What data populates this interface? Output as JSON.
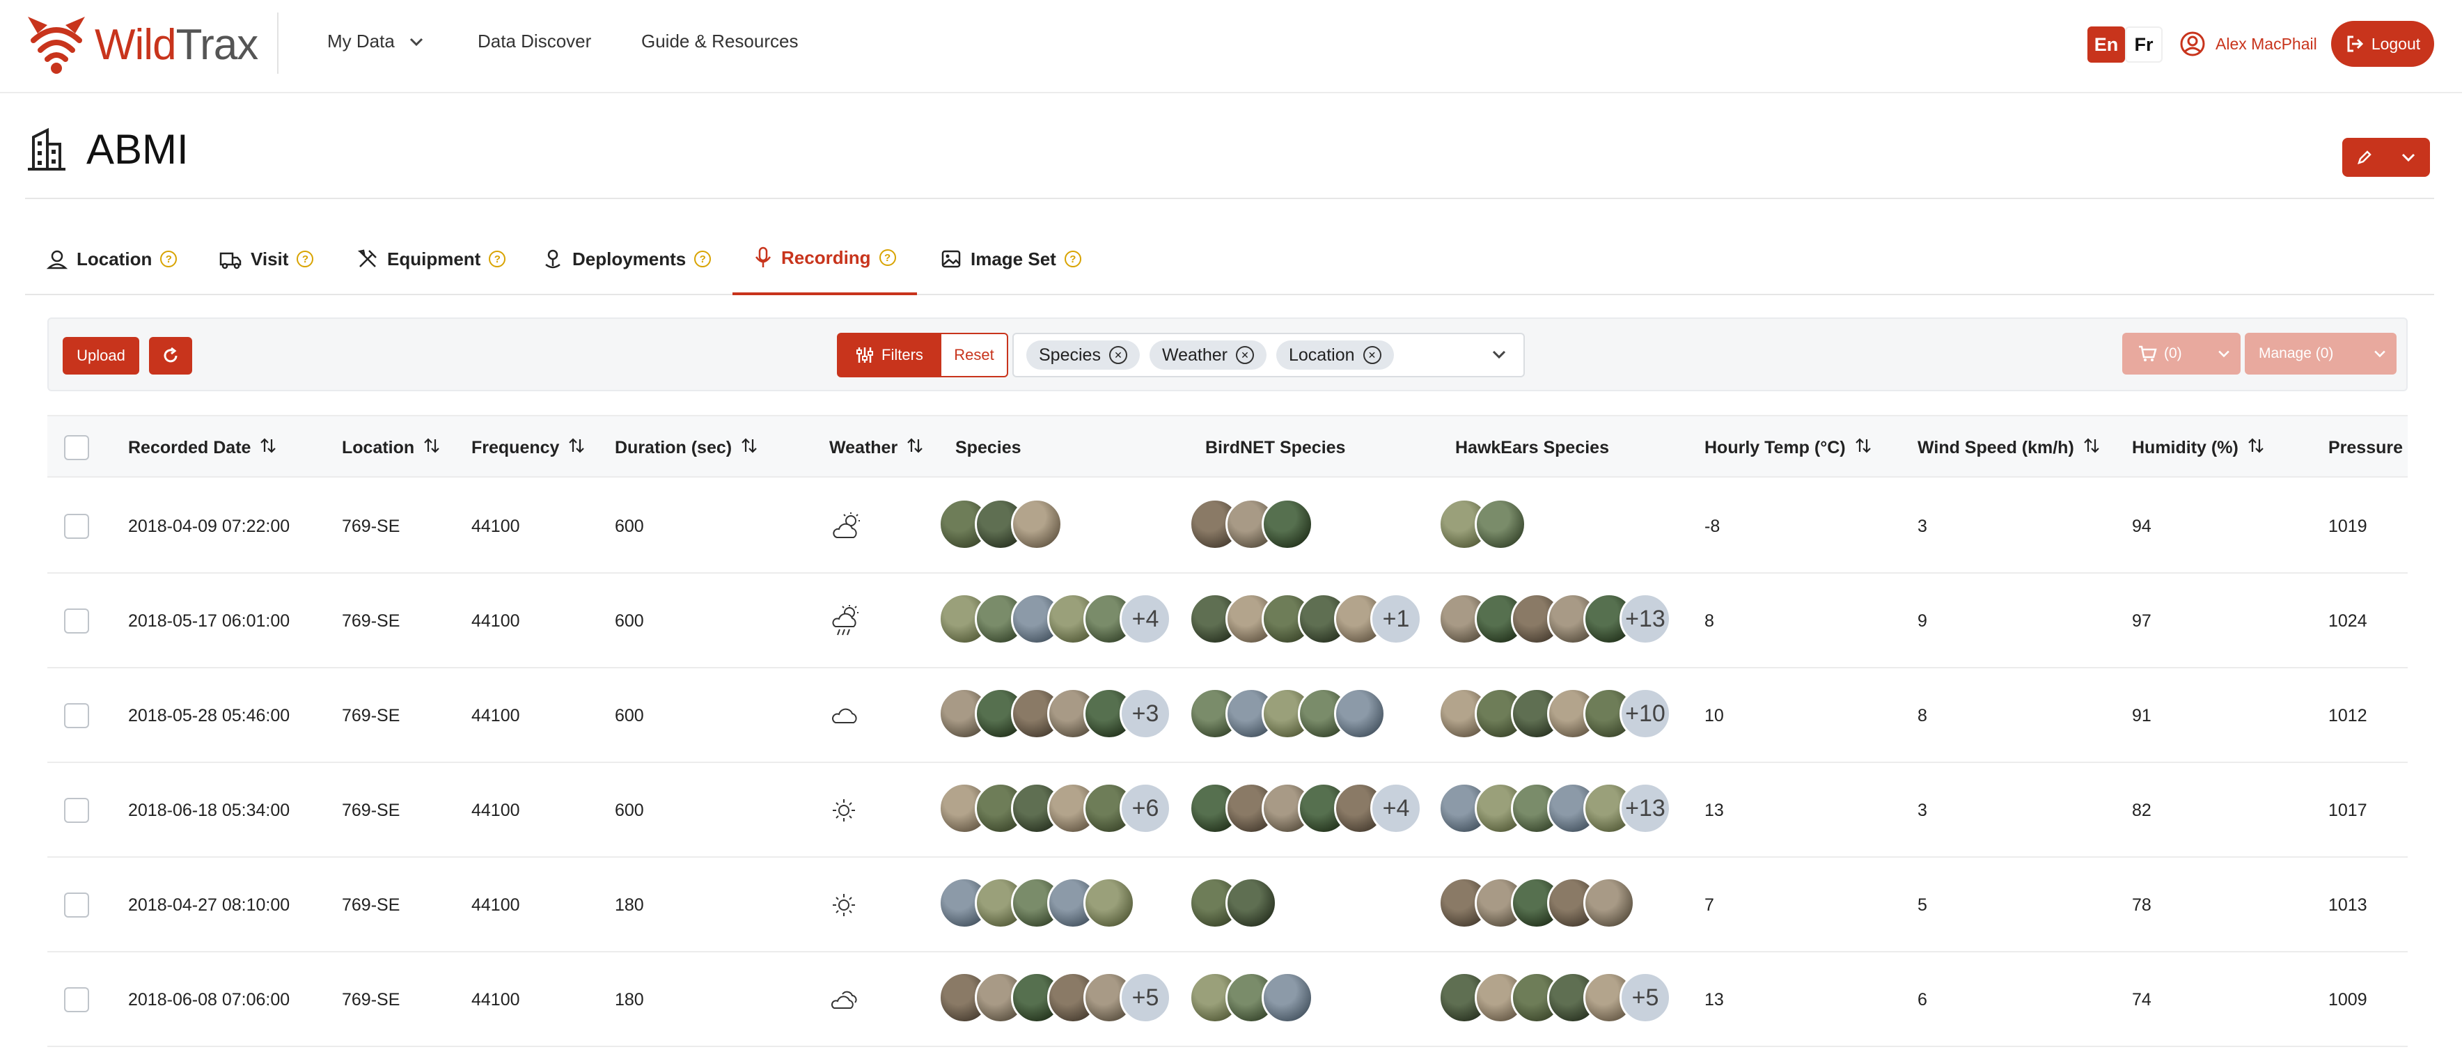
{
  "app": {
    "brand_wild": "Wild",
    "brand_trax": "Trax"
  },
  "nav": {
    "my_data": "My Data",
    "data_discover": "Data Discover",
    "guide": "Guide & Resources"
  },
  "lang": {
    "en": "En",
    "fr": "Fr"
  },
  "user": {
    "name": "Alex MacPhail",
    "logout": "Logout"
  },
  "page": {
    "title": "ABMI"
  },
  "tabs": [
    "Location",
    "Visit",
    "Equipment",
    "Deployments",
    "Recording",
    "Image Set"
  ],
  "active_tab": "Recording",
  "toolbar": {
    "upload": "Upload",
    "filters": "Filters",
    "reset": "Reset",
    "chips": [
      "Species",
      "Weather",
      "Location"
    ],
    "cart": "(0)",
    "manage": "Manage (0)"
  },
  "columns": [
    "Recorded Date",
    "Location",
    "Frequency",
    "Duration (sec)",
    "Weather",
    "Species",
    "BirdNET Species",
    "HawkEars Species",
    "Hourly Temp (°C)",
    "Wind Speed (km/h)",
    "Humidity (%)",
    "Pressure ("
  ],
  "rows": [
    {
      "date": "2018-04-09 07:22:00",
      "location": "769-SE",
      "frequency": "44100",
      "duration": "600",
      "weather": "partly-cloudy-icon",
      "species_n": 3,
      "species_more": "",
      "birdnet_n": 3,
      "birdnet_more": "",
      "hawkears_n": 2,
      "hawkears_more": "",
      "temp": "-8",
      "wind": "3",
      "humidity": "94",
      "pressure": "1019"
    },
    {
      "date": "2018-05-17 06:01:00",
      "location": "769-SE",
      "frequency": "44100",
      "duration": "600",
      "weather": "sun-rain-icon",
      "species_n": 5,
      "species_more": "+4",
      "birdnet_n": 5,
      "birdnet_more": "+1",
      "hawkears_n": 5,
      "hawkears_more": "+13",
      "temp": "8",
      "wind": "9",
      "humidity": "97",
      "pressure": "1024"
    },
    {
      "date": "2018-05-28 05:46:00",
      "location": "769-SE",
      "frequency": "44100",
      "duration": "600",
      "weather": "cloud-icon",
      "species_n": 5,
      "species_more": "+3",
      "birdnet_n": 5,
      "birdnet_more": "",
      "hawkears_n": 5,
      "hawkears_more": "+10",
      "temp": "10",
      "wind": "8",
      "humidity": "91",
      "pressure": "1012"
    },
    {
      "date": "2018-06-18 05:34:00",
      "location": "769-SE",
      "frequency": "44100",
      "duration": "600",
      "weather": "sun-icon",
      "species_n": 5,
      "species_more": "+6",
      "birdnet_n": 5,
      "birdnet_more": "+4",
      "hawkears_n": 5,
      "hawkears_more": "+13",
      "temp": "13",
      "wind": "3",
      "humidity": "82",
      "pressure": "1017"
    },
    {
      "date": "2018-04-27 08:10:00",
      "location": "769-SE",
      "frequency": "44100",
      "duration": "180",
      "weather": "sun-icon",
      "species_n": 5,
      "species_more": "",
      "birdnet_n": 2,
      "birdnet_more": "",
      "hawkears_n": 5,
      "hawkears_more": "",
      "temp": "7",
      "wind": "5",
      "humidity": "78",
      "pressure": "1013"
    },
    {
      "date": "2018-06-08 07:06:00",
      "location": "769-SE",
      "frequency": "44100",
      "duration": "180",
      "weather": "cloudy-icon",
      "species_n": 5,
      "species_more": "+5",
      "birdnet_n": 3,
      "birdnet_more": "",
      "hawkears_n": 5,
      "hawkears_more": "+5",
      "temp": "13",
      "wind": "6",
      "humidity": "74",
      "pressure": "1009"
    }
  ],
  "colors": {
    "accent": "#c8341c",
    "help": "#d8a300",
    "more_badge": "#c8d1dc"
  }
}
